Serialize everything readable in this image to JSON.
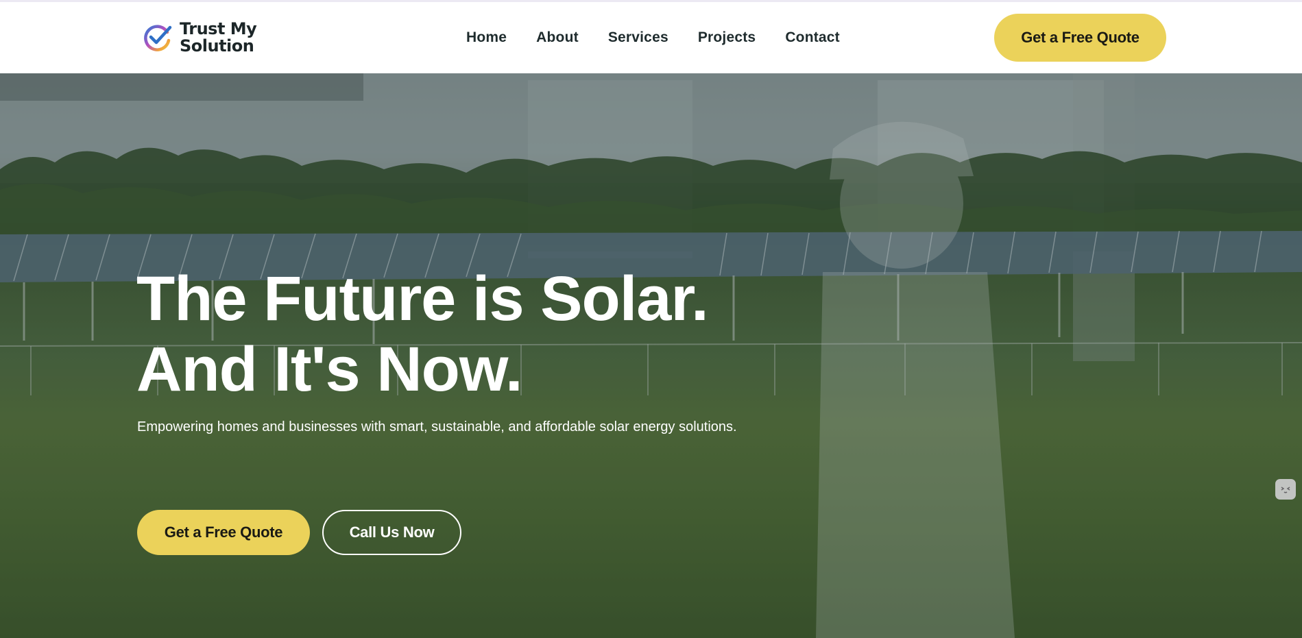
{
  "brand": {
    "line1": "Trust My",
    "line2": "Solution",
    "logo_icon": "check-circle-icon",
    "logo_colors": [
      "#2a7bd4",
      "#b24fc0",
      "#f2a33a",
      "#e8c94a"
    ]
  },
  "nav": {
    "items": [
      {
        "label": "Home"
      },
      {
        "label": "About"
      },
      {
        "label": "Services"
      },
      {
        "label": "Projects"
      },
      {
        "label": "Contact"
      }
    ],
    "cta_label": "Get a Free Quote"
  },
  "hero": {
    "title_line1": "The Future is Solar.",
    "title_line2": "And It's Now.",
    "subtitle": "Empowering homes and businesses with smart, sustainable, and affordable solar energy solutions.",
    "primary_cta": "Get a Free Quote",
    "secondary_cta": "Call Us Now"
  },
  "chat_widget": {
    "icon": "chat-bot-icon"
  },
  "colors": {
    "accent": "#ebd25a",
    "nav_text": "#1e2b2d",
    "hero_text": "#ffffff"
  }
}
